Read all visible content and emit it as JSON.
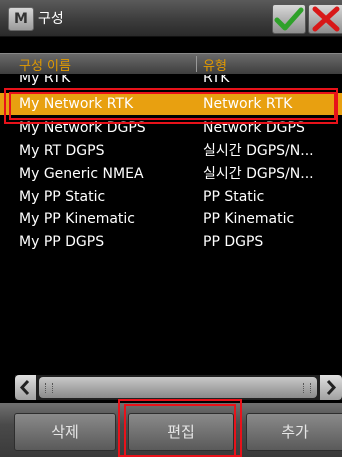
{
  "window": {
    "title": "구성",
    "app_icon_letter": "M"
  },
  "table": {
    "headers": {
      "name": "구성 이름",
      "type": "유형"
    },
    "rows": [
      {
        "name": "My RTK",
        "type": "RTK"
      },
      {
        "name": "My Network RTK",
        "type": "Network RTK"
      },
      {
        "name": "My Network DGPS",
        "type": "Network DGPS"
      },
      {
        "name": "My RT DGPS",
        "type": "실시간 DGPS/N..."
      },
      {
        "name": "My Generic NMEA",
        "type": "실시간 DGPS/N..."
      },
      {
        "name": "My PP Static",
        "type": "PP Static"
      },
      {
        "name": "My PP Kinematic",
        "type": "PP Kinematic"
      },
      {
        "name": "My PP DGPS",
        "type": "PP DGPS"
      }
    ],
    "selected_index": 1
  },
  "toolbar": {
    "delete_label": "삭제",
    "edit_label": "편집",
    "add_label": "추가"
  },
  "colors": {
    "selection": "#e8a010",
    "header_text": "#e29a00",
    "annotation": "#e8121a"
  }
}
